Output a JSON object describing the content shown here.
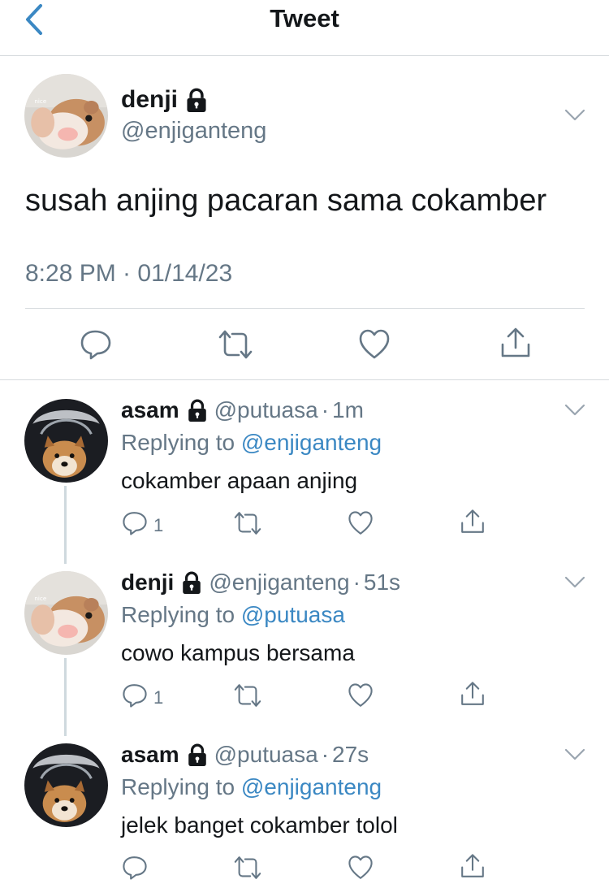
{
  "nav": {
    "title": "Tweet",
    "back_icon": "chevron-left-icon"
  },
  "colors": {
    "accent": "#3b88c3",
    "muted": "#657786",
    "text": "#14171a",
    "divider": "#d6dadd"
  },
  "main_tweet": {
    "name": "denji",
    "handle": "@enjiganteng",
    "text": "susah anjing pacaran sama cokamber",
    "timestamp": "8:28 PM · 01/14/23",
    "locked": true
  },
  "replies": [
    {
      "name": "asam",
      "handle": "@putuasa",
      "dot": "·",
      "time": "1m",
      "replying_prefix": "Replying to",
      "replying_to": "@enjiganteng",
      "text": "cokamber apaan anjing",
      "reply_count": "1"
    },
    {
      "name": "denji",
      "handle": "@enjiganteng",
      "dot": "·",
      "time": "51s",
      "replying_prefix": "Replying to",
      "replying_to": "@putuasa",
      "text": "cowo kampus bersama",
      "reply_count": "1"
    },
    {
      "name": "asam",
      "handle": "@putuasa",
      "dot": "·",
      "time": "27s",
      "replying_prefix": "Replying to",
      "replying_to": "@enjiganteng",
      "text": "jelek banget cokamber tolol",
      "reply_count": ""
    }
  ],
  "avatar_labels": {
    "hamster": "nice"
  },
  "icons": {
    "reply": "reply-icon",
    "retweet": "retweet-icon",
    "like": "heart-icon",
    "share": "share-icon",
    "lock": "lock-icon",
    "more": "chevron-down-icon"
  }
}
